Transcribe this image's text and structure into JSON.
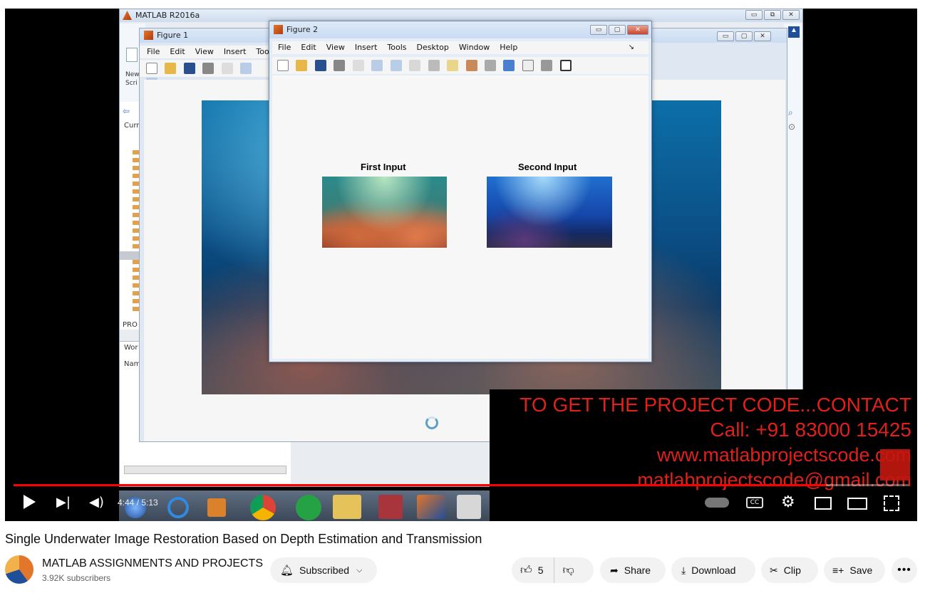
{
  "matlab": {
    "title": "MATLAB R2016a",
    "new_script_label": "New Scri",
    "current_folder_label": "Curr",
    "project_label": "PRO",
    "workspace_label": "Wor",
    "name_label": "Nam"
  },
  "figure1": {
    "title": "Figure 1",
    "menus": [
      "File",
      "Edit",
      "View",
      "Insert",
      "Too"
    ]
  },
  "figure2": {
    "title": "Figure 2",
    "menus": [
      "File",
      "Edit",
      "View",
      "Insert",
      "Tools",
      "Desktop",
      "Window",
      "Help"
    ],
    "axes": [
      {
        "title": "First Input"
      },
      {
        "title": "Second Input"
      }
    ]
  },
  "overlay": {
    "line1": "TO GET THE PROJECT CODE...CONTACT",
    "line2": "Call: +91 83000 15425",
    "line3": "www.matlabprojectscode.com",
    "line4": "matlabprojectscode@gmail.com"
  },
  "player": {
    "time_display": "4:44 / 5:13",
    "progress_fraction": 0.908
  },
  "video": {
    "title": "Single Underwater Image Restoration Based on Depth Estimation and Transmission"
  },
  "channel": {
    "name": "MATLAB ASSIGNMENTS AND PROJECTS",
    "subscribers": "3.92K subscribers"
  },
  "actions": {
    "subscribed_label": "Subscribed",
    "like_count": "5",
    "share_label": "Share",
    "download_label": "Download",
    "clip_label": "Clip",
    "save_label": "Save"
  },
  "colors": {
    "overlay_red": "#e0201a",
    "progress_red": "#ff0000"
  }
}
